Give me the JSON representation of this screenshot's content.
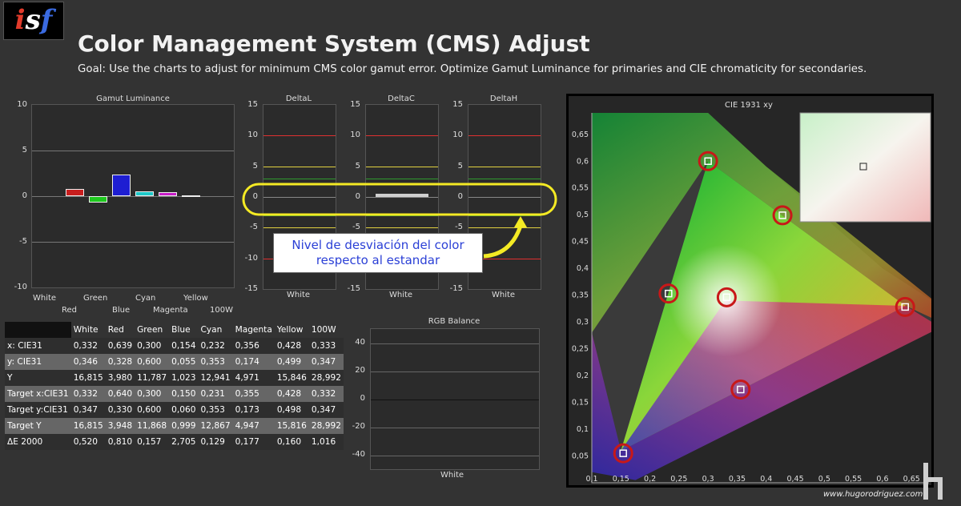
{
  "logo": {
    "text1": "i",
    "text2": "s",
    "text3": "f"
  },
  "header": {
    "title": "Color Management System (CMS) Adjust",
    "goal": "Goal: Use the charts to adjust for minimum CMS color gamut error. Optimize Gamut Luminance for primaries and CIE chromaticity for secondaries."
  },
  "gamut": {
    "title": "Gamut Luminance",
    "yticks": [
      "10",
      "5",
      "0",
      "-5",
      "-10"
    ],
    "xlabels_top": [
      "White",
      "Green",
      "Cyan",
      "Yellow"
    ],
    "xlabels_bottom": [
      "Red",
      "Blue",
      "Magenta",
      "100W"
    ]
  },
  "deltas": [
    {
      "title": "DeltaL",
      "xlabel": "White",
      "yticks": [
        "15",
        "10",
        "5",
        "0",
        "-5",
        "-10",
        "-15"
      ]
    },
    {
      "title": "DeltaC",
      "xlabel": "White",
      "yticks": [
        "15",
        "10",
        "5",
        "0",
        "-5",
        "-10",
        "-15"
      ]
    },
    {
      "title": "DeltaH",
      "xlabel": "White",
      "yticks": [
        "15",
        "10",
        "5",
        "0",
        "-5",
        "-10",
        "-15"
      ]
    }
  ],
  "rgb": {
    "title": "RGB Balance",
    "xlabel": "White",
    "yticks": [
      "40",
      "20",
      "0",
      "-20",
      "-40"
    ]
  },
  "annotation": {
    "line1": "Nivel de desviación del color",
    "line2": "respecto al estandar"
  },
  "table": {
    "headers": [
      "",
      "White",
      "Red",
      "Green",
      "Blue",
      "Cyan",
      "Magenta",
      "Yellow",
      "100W"
    ],
    "rows": [
      {
        "label": "x: CIE31",
        "values": [
          "0,332",
          "0,639",
          "0,300",
          "0,154",
          "0,232",
          "0,356",
          "0,428",
          "0,333"
        ]
      },
      {
        "label": "y: CIE31",
        "values": [
          "0,346",
          "0,328",
          "0,600",
          "0,055",
          "0,353",
          "0,174",
          "0,499",
          "0,347"
        ]
      },
      {
        "label": "Y",
        "values": [
          "16,815",
          "3,980",
          "11,787",
          "1,023",
          "12,941",
          "4,971",
          "15,846",
          "28,992"
        ]
      },
      {
        "label": "Target x:CIE31",
        "values": [
          "0,332",
          "0,640",
          "0,300",
          "0,150",
          "0,231",
          "0,355",
          "0,428",
          "0,332"
        ]
      },
      {
        "label": "Target y:CIE31",
        "values": [
          "0,347",
          "0,330",
          "0,600",
          "0,060",
          "0,353",
          "0,173",
          "0,498",
          "0,347"
        ]
      },
      {
        "label": "Target Y",
        "values": [
          "16,815",
          "3,948",
          "11,868",
          "0,999",
          "12,867",
          "4,947",
          "15,816",
          "28,992"
        ]
      },
      {
        "label": "ΔE 2000",
        "values": [
          "0,520",
          "0,810",
          "0,157",
          "2,705",
          "0,129",
          "0,177",
          "0,160",
          "1,016"
        ]
      }
    ]
  },
  "cie": {
    "title": "CIE 1931 xy",
    "yticks": [
      "0,65",
      "0,6",
      "0,55",
      "0,5",
      "0,45",
      "0,4",
      "0,35",
      "0,3",
      "0,25",
      "0,2",
      "0,15",
      "0,1",
      "0,05"
    ],
    "xticks": [
      "0,1",
      "0,15",
      "0,2",
      "0,25",
      "0,3",
      "0,35",
      "0,4",
      "0,45",
      "0,5",
      "0,55",
      "0,6",
      "0,65"
    ]
  },
  "footer": {
    "credit": "www.hugorodriguez.com"
  },
  "chart_data": [
    {
      "type": "bar",
      "title": "Gamut Luminance",
      "categories": [
        "White",
        "Red",
        "Green",
        "Blue",
        "Cyan",
        "Magenta",
        "Yellow",
        "100W"
      ],
      "values": [
        0,
        0.8,
        -0.7,
        2.4,
        0.5,
        0.4,
        0.1,
        0
      ],
      "ylim": [
        -10,
        10
      ],
      "colors": [
        "#888888",
        "#c81e1e",
        "#1ec81e",
        "#1e1ed2",
        "#1ec8c8",
        "#c81ec8",
        "#c8c81e",
        "#888888"
      ]
    },
    {
      "type": "bar",
      "title": "DeltaL",
      "categories": [
        "White"
      ],
      "values": [
        0
      ],
      "ylim": [
        -15,
        15
      ]
    },
    {
      "type": "bar",
      "title": "DeltaC",
      "categories": [
        "White"
      ],
      "values": [
        0.5
      ],
      "ylim": [
        -15,
        15
      ]
    },
    {
      "type": "bar",
      "title": "DeltaH",
      "categories": [
        "White"
      ],
      "values": [
        0
      ],
      "ylim": [
        -15,
        15
      ]
    },
    {
      "type": "bar",
      "title": "RGB Balance",
      "categories": [
        "White"
      ],
      "values": [
        0
      ],
      "ylim": [
        -50,
        50
      ]
    },
    {
      "type": "scatter",
      "title": "CIE 1931 xy",
      "xlim": [
        0.1,
        0.68
      ],
      "ylim": [
        0,
        0.69
      ],
      "points": [
        {
          "name": "Red",
          "x": 0.639,
          "y": 0.328
        },
        {
          "name": "Green",
          "x": 0.3,
          "y": 0.6
        },
        {
          "name": "Blue",
          "x": 0.154,
          "y": 0.055
        },
        {
          "name": "Cyan",
          "x": 0.232,
          "y": 0.353
        },
        {
          "name": "Magenta",
          "x": 0.356,
          "y": 0.174
        },
        {
          "name": "Yellow",
          "x": 0.428,
          "y": 0.499
        },
        {
          "name": "White",
          "x": 0.332,
          "y": 0.346
        }
      ]
    }
  ]
}
